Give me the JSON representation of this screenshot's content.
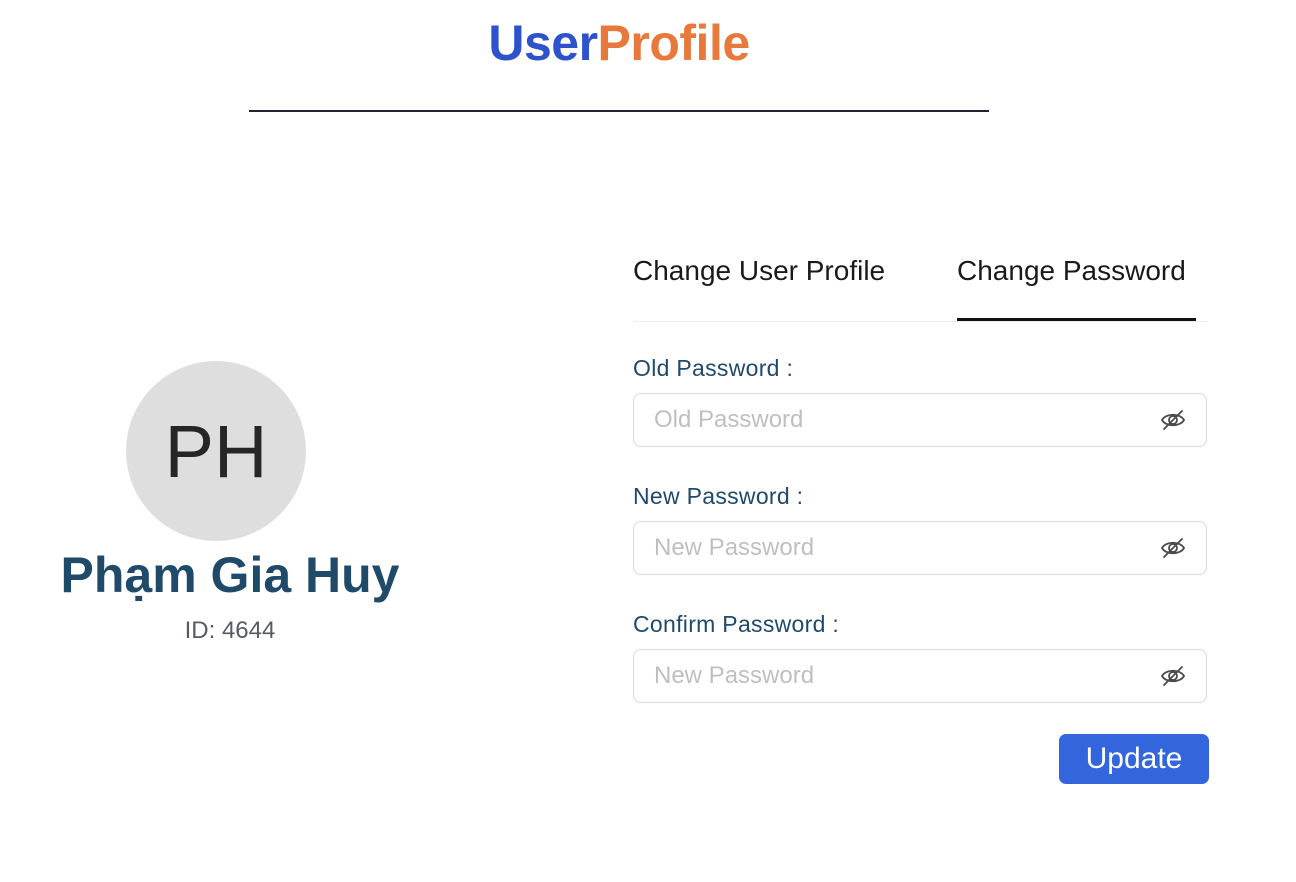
{
  "brand": {
    "part_a": "User",
    "part_b": "Profile"
  },
  "profile": {
    "initials": "PH",
    "name": "Phạm Gia Huy",
    "id_text": "ID: 4644"
  },
  "tabs": [
    {
      "label": "Change User Profile",
      "active": false
    },
    {
      "label": "Change Password",
      "active": true
    }
  ],
  "form": {
    "old_password": {
      "label": "Old Password :",
      "placeholder": "Old Password",
      "value": ""
    },
    "new_password": {
      "label": "New Password :",
      "placeholder": "New Password",
      "value": ""
    },
    "confirm_password": {
      "label": "Confirm Password :",
      "placeholder": "New Password",
      "value": ""
    },
    "submit_label": "Update"
  },
  "icons": {
    "visibility_toggle": "eye-slash-icon"
  },
  "colors": {
    "brand_blue": "#2d52cc",
    "brand_orange": "#e8793c",
    "label_navy": "#204a6a",
    "button_blue": "#3366dd"
  }
}
